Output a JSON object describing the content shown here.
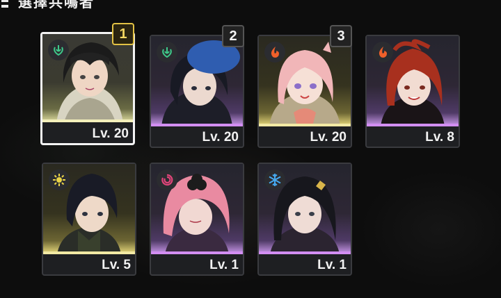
{
  "header": {
    "title": "選擇共鳴者"
  },
  "characters": [
    {
      "level": "Lv. 20",
      "rank": "1",
      "element": "aero-icon",
      "element_color": "#3ec98a"
    },
    {
      "level": "Lv. 20",
      "rank": "2",
      "element": "aero-icon",
      "element_color": "#3ec98a"
    },
    {
      "level": "Lv. 20",
      "rank": "3",
      "element": "fusion-icon",
      "element_color": "#f0602a"
    },
    {
      "level": "Lv. 8",
      "element": "fusion-icon",
      "element_color": "#f0602a"
    },
    {
      "level": "Lv. 5",
      "element": "spectro-icon",
      "element_color": "#e9d347"
    },
    {
      "level": "Lv. 1",
      "element": "havoc-icon",
      "element_color": "#e0457a"
    },
    {
      "level": "Lv. 1",
      "element": "glacio-icon",
      "element_color": "#46a9ee"
    }
  ],
  "colors": {
    "rank_gold": "#e3c245",
    "selected_border": "#f3f3f3",
    "purple_rarity": "#d28ef2",
    "gold_rarity": "#f2e9a4"
  }
}
